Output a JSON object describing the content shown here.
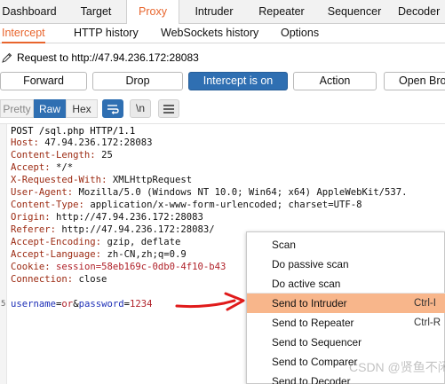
{
  "top_tabs": [
    {
      "label": "Dashboard",
      "active": false
    },
    {
      "label": "Target",
      "active": false
    },
    {
      "label": "Proxy",
      "active": true
    },
    {
      "label": "Intruder",
      "active": false
    },
    {
      "label": "Repeater",
      "active": false
    },
    {
      "label": "Sequencer",
      "active": false
    },
    {
      "label": "Decoder",
      "active": false
    }
  ],
  "sub_tabs": [
    {
      "label": "Intercept",
      "active": true
    },
    {
      "label": "HTTP history",
      "active": false
    },
    {
      "label": "WebSockets history",
      "active": false
    },
    {
      "label": "Options",
      "active": false
    }
  ],
  "request_line": "Request to http://47.94.236.172:28083",
  "buttons": {
    "forward": "Forward",
    "drop": "Drop",
    "intercept": "Intercept is on",
    "action": "Action",
    "open_browser": "Open Brow"
  },
  "editor_toolbar": {
    "pretty": "Pretty",
    "raw": "Raw",
    "hex": "Hex",
    "newline_toggle": "\\n"
  },
  "request": {
    "first_line": "POST /sql.php HTTP/1.1",
    "headers": [
      {
        "key": "Host",
        "value": " 47.94.236.172:28083"
      },
      {
        "key": "Content-Length",
        "value": " 25"
      },
      {
        "key": "Accept",
        "value": " */*"
      },
      {
        "key": "X-Requested-With",
        "value": " XMLHttpRequest"
      },
      {
        "key": "User-Agent",
        "value": " Mozilla/5.0 (Windows NT 10.0; Win64; x64) AppleWebKit/537."
      },
      {
        "key": "Content-Type",
        "value": " application/x-www-form-urlencoded; charset=UTF-8"
      },
      {
        "key": "Origin",
        "value": " http://47.94.236.172:28083"
      },
      {
        "key": "Referer",
        "value": " http://47.94.236.172:28083/"
      },
      {
        "key": "Accept-Encoding",
        "value": " gzip, deflate"
      },
      {
        "key": "Accept-Language",
        "value": " zh-CN,zh;q=0.9"
      },
      {
        "key": "Cookie",
        "value": " session=58eb169c-0db0-4f10-b43"
      },
      {
        "key": "Connection",
        "value": " close"
      }
    ],
    "body": {
      "p1_key": "username",
      "eq1": "=",
      "p1_val": "or",
      "amp": "&",
      "p2_key": "password",
      "eq2": "=",
      "p2_val": "1234"
    },
    "line_numbers": [
      "5"
    ]
  },
  "context_menu": {
    "items": [
      {
        "label": "Scan",
        "shortcut": ""
      },
      {
        "label": "Do passive scan",
        "shortcut": ""
      },
      {
        "label": "Do active scan",
        "shortcut": ""
      },
      {
        "label": "Send to Intruder",
        "shortcut": "Ctrl-I",
        "highlighted": true
      },
      {
        "label": "Send to Repeater",
        "shortcut": "Ctrl-R"
      },
      {
        "label": "Send to Sequencer",
        "shortcut": ""
      },
      {
        "label": "Send to Comparer",
        "shortcut": ""
      },
      {
        "label": "Send to Decoder",
        "shortcut": ""
      }
    ]
  },
  "watermark": "CSDN @贤鱼不闲",
  "colors": {
    "accent_orange": "#e8652d",
    "intercept_blue": "#2f6fb2",
    "menu_highlight": "#f8b68b",
    "arrow_red": "#e01a1a"
  }
}
